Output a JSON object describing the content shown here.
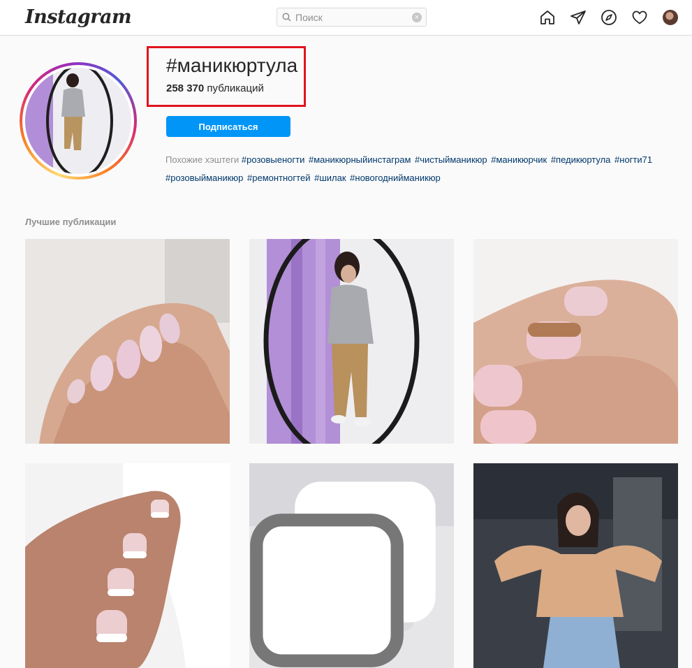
{
  "nav": {
    "logo": "Instagram",
    "search_placeholder": "Поиск",
    "clear_symbol": "×"
  },
  "header": {
    "hashtag": "#маникюртула",
    "post_count": "258 370",
    "post_count_label": " публикаций",
    "follow_button": "Подписаться",
    "related_label": "Похожие хэштеги",
    "related_tags": [
      "#розовыеногти",
      "#маникюрныйинстаграм",
      "#чистыйманикюр",
      "#маникюрчик",
      "#педикюртула",
      "#ногти71",
      "#розовыйманикюр",
      "#ремонтногтей",
      "#шилак",
      "#новогоднийманикюр"
    ]
  },
  "top_posts": {
    "title": "Лучшие публикации",
    "posts": [
      {
        "name": "post-pink-glitter-nails",
        "icon": "none"
      },
      {
        "name": "post-mirror-selfie",
        "icon": "none"
      },
      {
        "name": "post-gold-glitter-nails",
        "icon": "none"
      },
      {
        "name": "post-french-manicure",
        "icon": "none"
      },
      {
        "name": "post-purple-bracelet",
        "icon": "carousel-icon"
      },
      {
        "name": "post-heart-hands-selfie",
        "icon": "none"
      }
    ]
  },
  "colors": {
    "accent": "#0095f6",
    "highlight": "#e0141e",
    "link": "#00376b",
    "muted": "#8e8e8e"
  }
}
